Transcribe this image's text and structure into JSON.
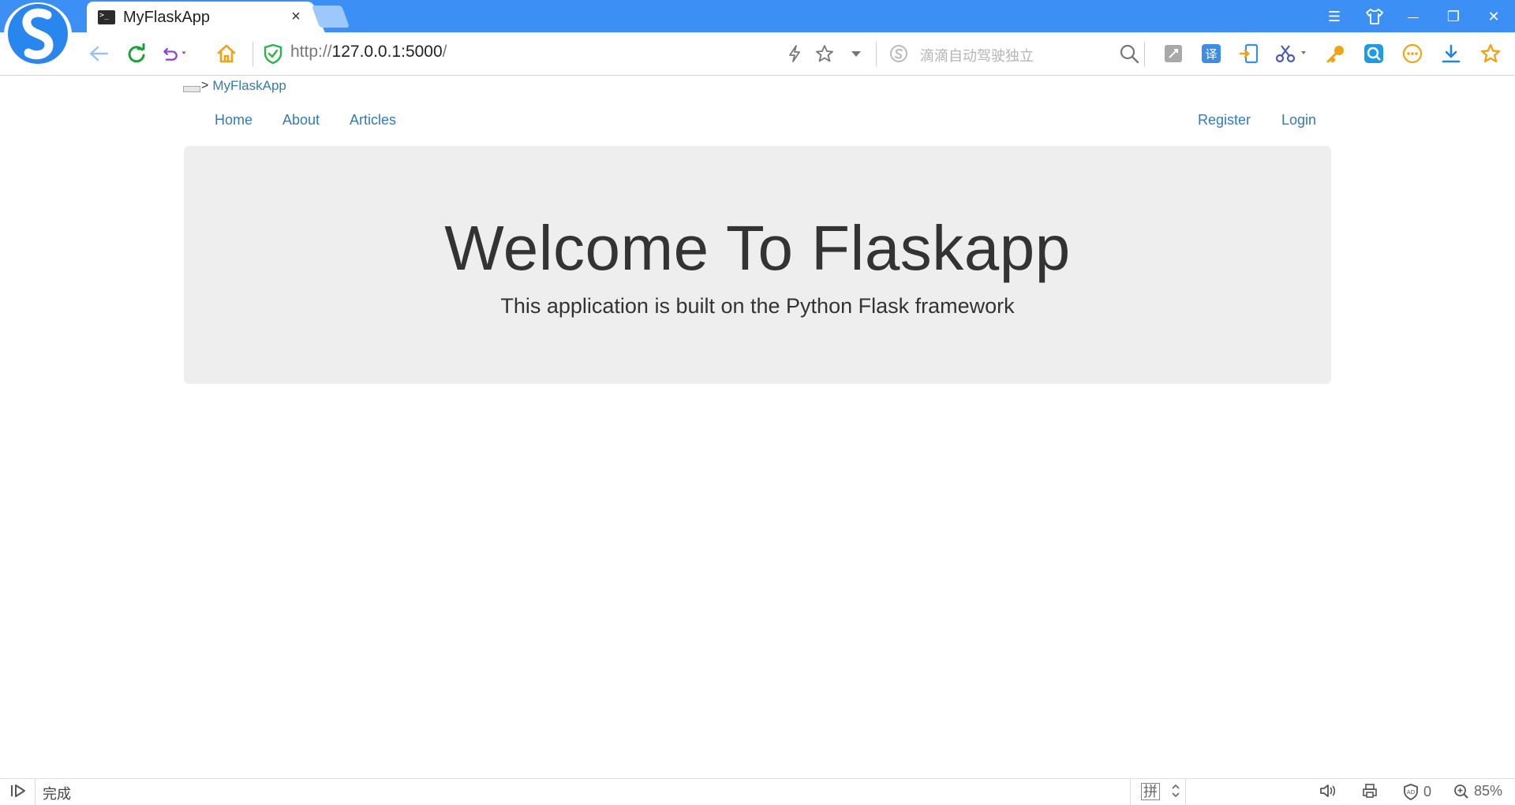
{
  "browser": {
    "tab": {
      "title": "MyFlaskApp",
      "close_glyph": "×"
    },
    "window_controls": {
      "menu": "☰",
      "minimize": "—",
      "restore": "❐",
      "close": "✕"
    },
    "address": {
      "prefix": "http://",
      "host": "127.0.0.1:5000",
      "suffix": "/"
    },
    "search_placeholder": "滴滴自动驾驶独立",
    "accent_color": "#3c8ff4"
  },
  "page": {
    "brand": {
      "arrow": ">",
      "label": "MyFlaskApp"
    },
    "nav_left": [
      {
        "label": "Home"
      },
      {
        "label": "About"
      },
      {
        "label": "Articles"
      }
    ],
    "nav_right": [
      {
        "label": "Register"
      },
      {
        "label": "Login"
      }
    ],
    "jumbotron": {
      "title": "Welcome To Flaskapp",
      "subtitle": "This application is built on the Python Flask framework"
    },
    "link_color": "#337ab7"
  },
  "statusbar": {
    "status": "完成",
    "ime": "拼",
    "adblock_count": "0",
    "zoom": "85%"
  }
}
